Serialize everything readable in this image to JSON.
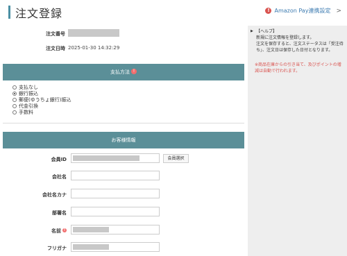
{
  "header": {
    "title": "注文登録",
    "amazon_link": "Amazon Pay連携設定"
  },
  "order": {
    "order_number_label": "注文番号",
    "order_date_label": "注文日時",
    "order_date_value": "2025-01-30 14:32:29"
  },
  "payment": {
    "section_title": "支払方法",
    "options": [
      "支払なし",
      "銀行振込",
      "郵便(ゆうちょ銀行)振込",
      "代金引換",
      "手数料"
    ],
    "selected_index": 1
  },
  "customer": {
    "section_title": "お客様情報",
    "fields": [
      {
        "label": "会員ID"
      },
      {
        "label": "会社名"
      },
      {
        "label": "会社名カナ"
      },
      {
        "label": "部署名"
      },
      {
        "label": "名前"
      },
      {
        "label": "フリガナ"
      }
    ],
    "member_select_button": "会員選択"
  },
  "help": {
    "heading": "【ヘルプ】",
    "lines": [
      "新規に注文情報を登録します。",
      "注文を保存すると、注文ステータスは「受注待ち」、注文日は保存した日付となります。"
    ],
    "note": "※商品在庫からの引き当て、及びポイントの増減は自動で行われます。"
  },
  "colors": {
    "accent": "#4a8fa3",
    "section_header": "#5b8f98",
    "required": "#f26d6d",
    "note": "#d9534f"
  }
}
